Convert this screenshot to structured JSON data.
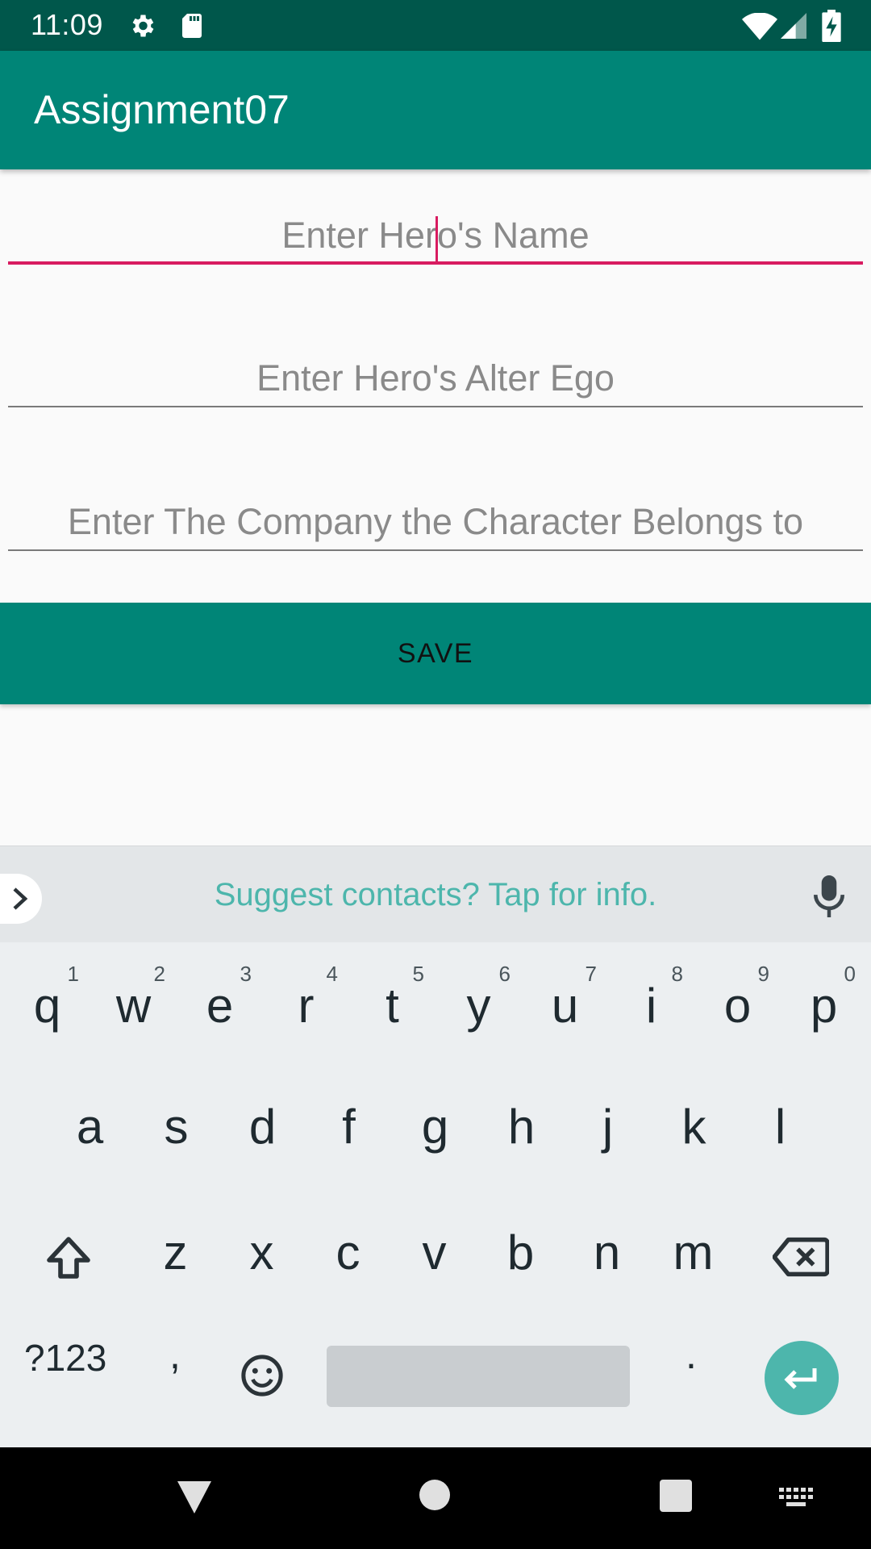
{
  "status_bar": {
    "time": "11:09"
  },
  "app_bar": {
    "title": "Assignment07"
  },
  "form": {
    "name_placeholder": "Enter Hero's Name",
    "alter_ego_placeholder": "Enter Hero's Alter Ego",
    "company_placeholder": "Enter The Company the Character Belongs to",
    "save_label": "SAVE"
  },
  "keyboard": {
    "suggestion": "Suggest contacts? Tap for info.",
    "row1": [
      {
        "key": "q",
        "hint": "1"
      },
      {
        "key": "w",
        "hint": "2"
      },
      {
        "key": "e",
        "hint": "3"
      },
      {
        "key": "r",
        "hint": "4"
      },
      {
        "key": "t",
        "hint": "5"
      },
      {
        "key": "y",
        "hint": "6"
      },
      {
        "key": "u",
        "hint": "7"
      },
      {
        "key": "i",
        "hint": "8"
      },
      {
        "key": "o",
        "hint": "9"
      },
      {
        "key": "p",
        "hint": "0"
      }
    ],
    "row2": [
      "a",
      "s",
      "d",
      "f",
      "g",
      "h",
      "j",
      "k",
      "l"
    ],
    "row3": [
      "z",
      "x",
      "c",
      "v",
      "b",
      "n",
      "m"
    ],
    "symbols_label": "?123",
    "comma_label": ",",
    "period_label": "."
  },
  "colors": {
    "primary": "#008577",
    "primary_dark": "#00574b",
    "accent": "#d81b60",
    "keyboard_accent": "#4db6ac"
  }
}
